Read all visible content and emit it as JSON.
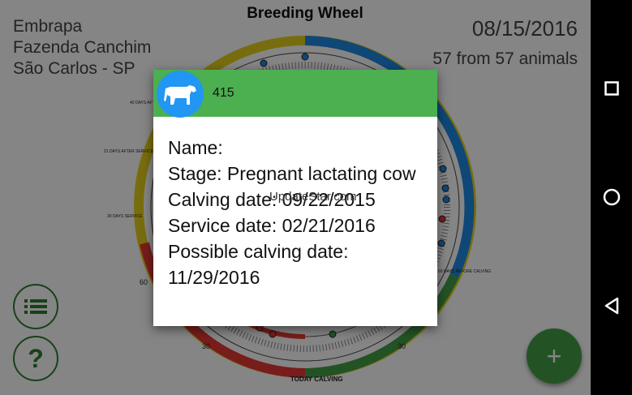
{
  "app": {
    "title": "Breeding Wheel",
    "farm_lines": [
      "Embrapa",
      "Fazenda Canchim",
      "São Carlos - SP"
    ],
    "date": "08/15/2016",
    "animal_count": "57 from 57 animals"
  },
  "wheel": {
    "labels": {
      "after_service_40": "40 DAYS AFTER SERVICE",
      "after_service_21": "21 DAYS AFTER SERVICE",
      "service_30": "30 DAYS SERVICE",
      "before_calving_60": "60 DAYS BEFORE CALVING",
      "today_calving": "TODAY CALVING",
      "tick_60": "60",
      "tick_30_left": "30",
      "tick_30_right": "30"
    },
    "colors": {
      "blue": "#1e88e5",
      "yellow": "#e6d21c",
      "red": "#e53935",
      "green": "#43a047"
    }
  },
  "dialog": {
    "id": "415",
    "name_line": "Name:",
    "stage_line": "Stage: Pregnant lactating cow",
    "calving_line": "Calving date: 09/22/2015",
    "service_line": "Service date: 02/21/2016",
    "possible_calving_line": "Possible calving date: 11/29/2016",
    "watermark": "UpdateStar.com",
    "avatar_icon": "cow-icon",
    "header_color": "#4caf50",
    "avatar_color": "#2196f3"
  },
  "buttons": {
    "list_icon": "list-icon",
    "help_label": "?",
    "add_label": "+"
  },
  "navbar": {
    "recents_icon": "square-icon",
    "home_icon": "circle-icon",
    "back_icon": "triangle-back-icon"
  }
}
